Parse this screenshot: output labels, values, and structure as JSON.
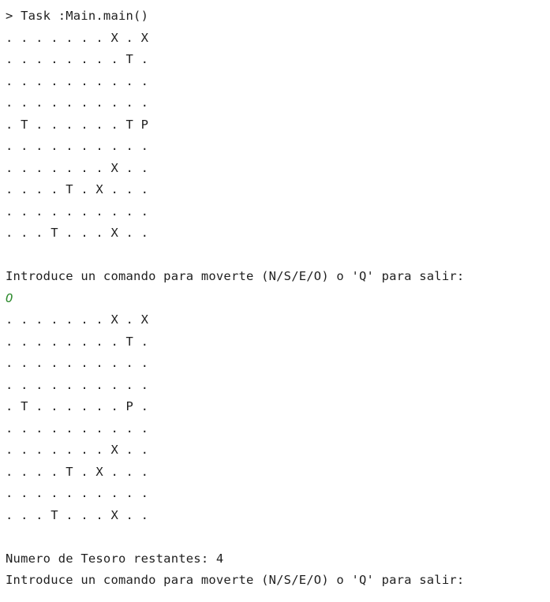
{
  "console": {
    "task_line": "> Task :Main.main()",
    "grid1": [
      ". . . . . . . X . X",
      ". . . . . . . . T .",
      ". . . . . . . . . .",
      ". . . . . . . . . .",
      ". T . . . . . . T P",
      ". . . . . . . . . .",
      ". . . . . . . X . .",
      ". . . . T . X . . .",
      ". . . . . . . . . .",
      ". . . T . . . X . ."
    ],
    "prompt1": "Introduce un comando para moverte (N/S/E/O) o 'Q' para salir:",
    "user_input": "O",
    "grid2": [
      ". . . . . . . X . X",
      ". . . . . . . . T .",
      ". . . . . . . . . .",
      ". . . . . . . . . .",
      ". T . . . . . . P .",
      ". . . . . . . . . .",
      ". . . . . . . X . .",
      ". . . . T . X . . .",
      ". . . . . . . . . .",
      ". . . T . . . X . ."
    ],
    "treasure_status": "Numero de Tesoro restantes: 4",
    "prompt2": "Introduce un comando para moverte (N/S/E/O) o 'Q' para salir:"
  },
  "colors": {
    "background": "#ffffff",
    "text": "#1f1f1f",
    "user_input": "#2e8b2e"
  }
}
